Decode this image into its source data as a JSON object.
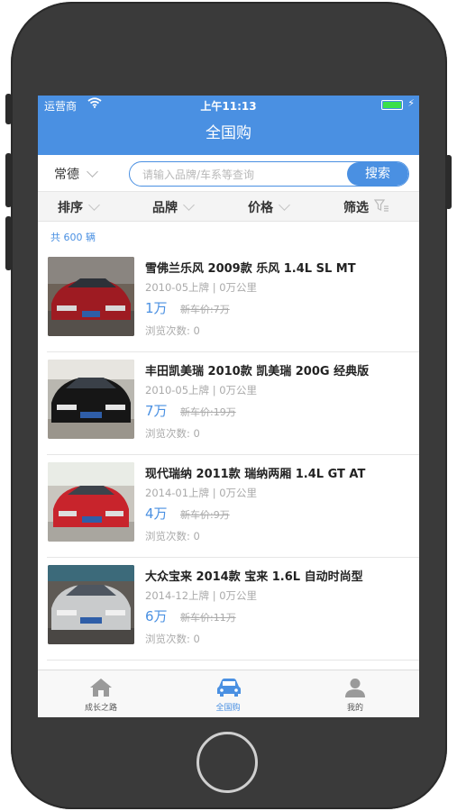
{
  "status_bar": {
    "carrier": "运营商",
    "time": "上午11:13"
  },
  "nav": {
    "title": "全国购"
  },
  "search": {
    "city": "常德",
    "placeholder": "请输入品牌/车系等查询",
    "button": "搜索"
  },
  "filters": [
    {
      "label": "排序"
    },
    {
      "label": "品牌"
    },
    {
      "label": "价格"
    },
    {
      "label": "筛选"
    }
  ],
  "count_text": "共 600 辆",
  "listings": [
    {
      "title": "雪佛兰乐风 2009款 乐风 1.4L SL MT",
      "meta": "2010-05上牌 | 0万公里",
      "price": "1万",
      "new_price": "新车价:7万",
      "views": "浏览次数: 0",
      "car_color": "#9e1b22"
    },
    {
      "title": "丰田凯美瑞 2010款 凯美瑞 200G 经典版",
      "meta": "2010-05上牌 | 0万公里",
      "price": "7万",
      "new_price": "新车价:19万",
      "views": "浏览次数: 0",
      "car_color": "#161616"
    },
    {
      "title": "现代瑞纳 2011款 瑞纳两厢 1.4L GT AT",
      "meta": "2014-01上牌 | 0万公里",
      "price": "4万",
      "new_price": "新车价:9万",
      "views": "浏览次数: 0",
      "car_color": "#c8242c"
    },
    {
      "title": "大众宝来 2014款 宝来 1.6L 自动时尚型",
      "meta": "2014-12上牌 | 0万公里",
      "price": "6万",
      "new_price": "新车价:11万",
      "views": "浏览次数: 0",
      "car_color": "#c9cbcc"
    }
  ],
  "tabs": [
    {
      "label": "成长之路",
      "icon": "home-icon"
    },
    {
      "label": "全国购",
      "icon": "car-icon"
    },
    {
      "label": "我的",
      "icon": "person-icon"
    }
  ],
  "colors": {
    "accent": "#4a90e2",
    "phone_body": "#3a3a3a"
  }
}
